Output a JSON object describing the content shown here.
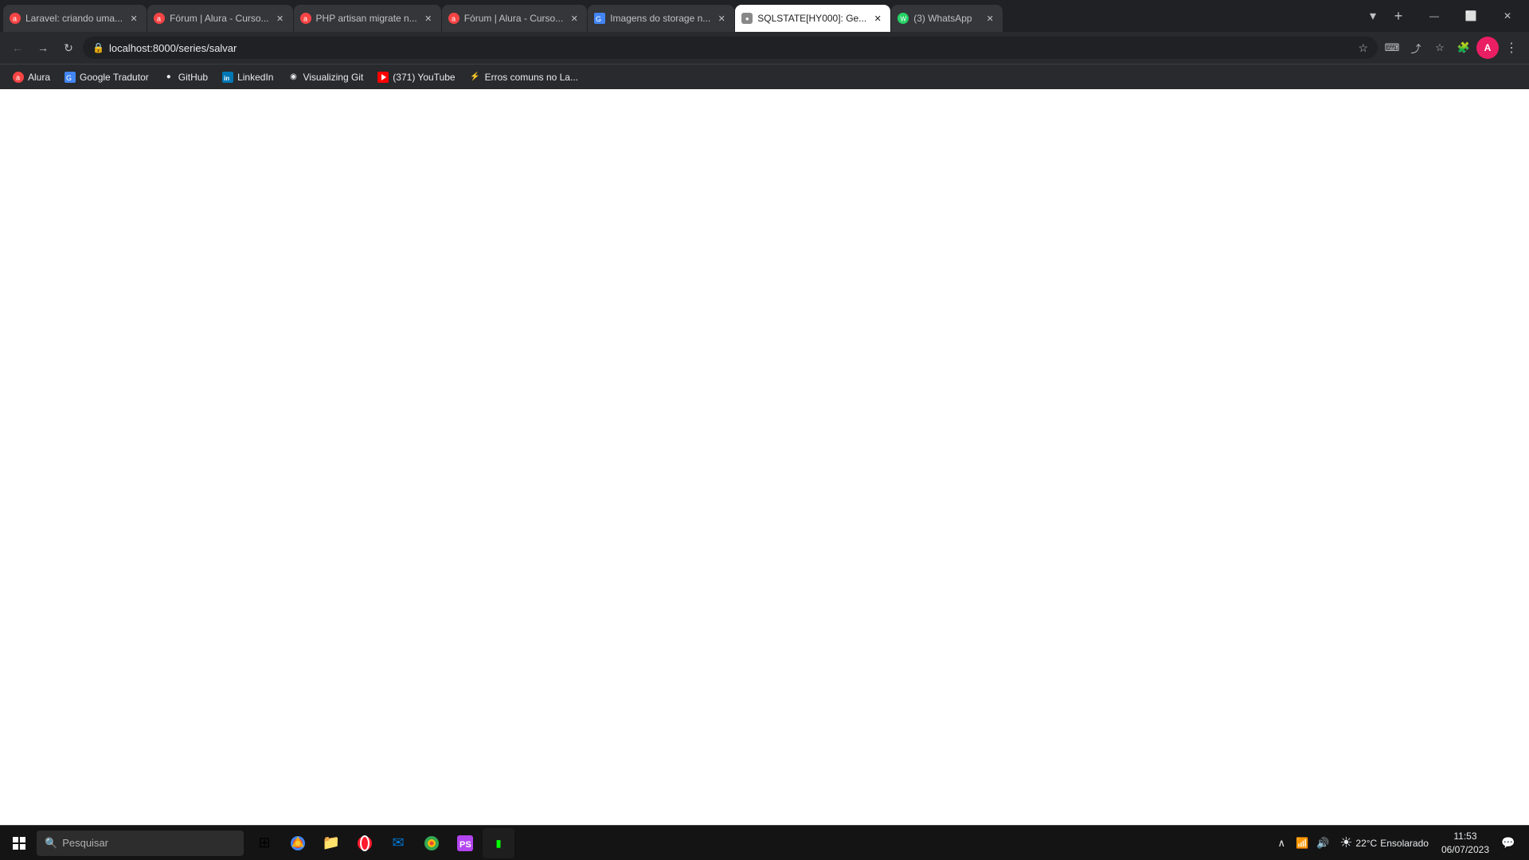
{
  "window": {
    "title": "SQLSTATE[HY000]: Ge..."
  },
  "tabs": [
    {
      "id": "tab1",
      "title": "Laravel: criando uma...",
      "favicon_color": "#f84444",
      "favicon_letter": "a",
      "active": false
    },
    {
      "id": "tab2",
      "title": "Fórum | Alura - Curso...",
      "favicon_color": "#f84444",
      "favicon_letter": "a",
      "active": false
    },
    {
      "id": "tab3",
      "title": "PHP artisan migrate n...",
      "favicon_color": "#f84444",
      "favicon_letter": "a",
      "active": false
    },
    {
      "id": "tab4",
      "title": "Fórum | Alura - Curso...",
      "favicon_color": "#f84444",
      "favicon_letter": "a",
      "active": false
    },
    {
      "id": "tab5",
      "title": "Imagens do storage n...",
      "favicon_color": "#4285f4",
      "favicon_letter": "G",
      "active": false
    },
    {
      "id": "tab6",
      "title": "SQLSTATE[HY000]: Ge...",
      "favicon_color": "#e8eaed",
      "favicon_letter": "●",
      "active": true
    },
    {
      "id": "tab7",
      "title": "(3) WhatsApp",
      "favicon_color": "#25d366",
      "favicon_letter": "W",
      "active": false
    }
  ],
  "address_bar": {
    "url": "localhost:8000/series/salvar",
    "lock_icon": "🔒"
  },
  "bookmarks": [
    {
      "id": "bm1",
      "label": "Alura",
      "favicon": "a",
      "favicon_color": "#f84444"
    },
    {
      "id": "bm2",
      "label": "Google Tradutor",
      "favicon": "G",
      "favicon_color": "#4285f4"
    },
    {
      "id": "bm3",
      "label": "GitHub",
      "favicon": "●",
      "favicon_color": "#ffffff"
    },
    {
      "id": "bm4",
      "label": "LinkedIn",
      "favicon": "in",
      "favicon_color": "#0077b5"
    },
    {
      "id": "bm5",
      "label": "Visualizing Git",
      "favicon": "◉",
      "favicon_color": "#ff6600"
    },
    {
      "id": "bm6",
      "label": "(371) YouTube",
      "favicon": "▶",
      "favicon_color": "#ff0000"
    },
    {
      "id": "bm7",
      "label": "Erros comuns no La...",
      "favicon": "⚡",
      "favicon_color": "#888888"
    }
  ],
  "taskbar": {
    "search_placeholder": "Pesquisar",
    "weather": {
      "temp": "22°C",
      "condition": "Ensolarado",
      "icon": "☀"
    },
    "clock": {
      "time": "11:53",
      "date": "06/07/2023"
    }
  },
  "nav_buttons": {
    "back": "←",
    "forward": "→",
    "reload": "↻",
    "home": "⌂"
  }
}
